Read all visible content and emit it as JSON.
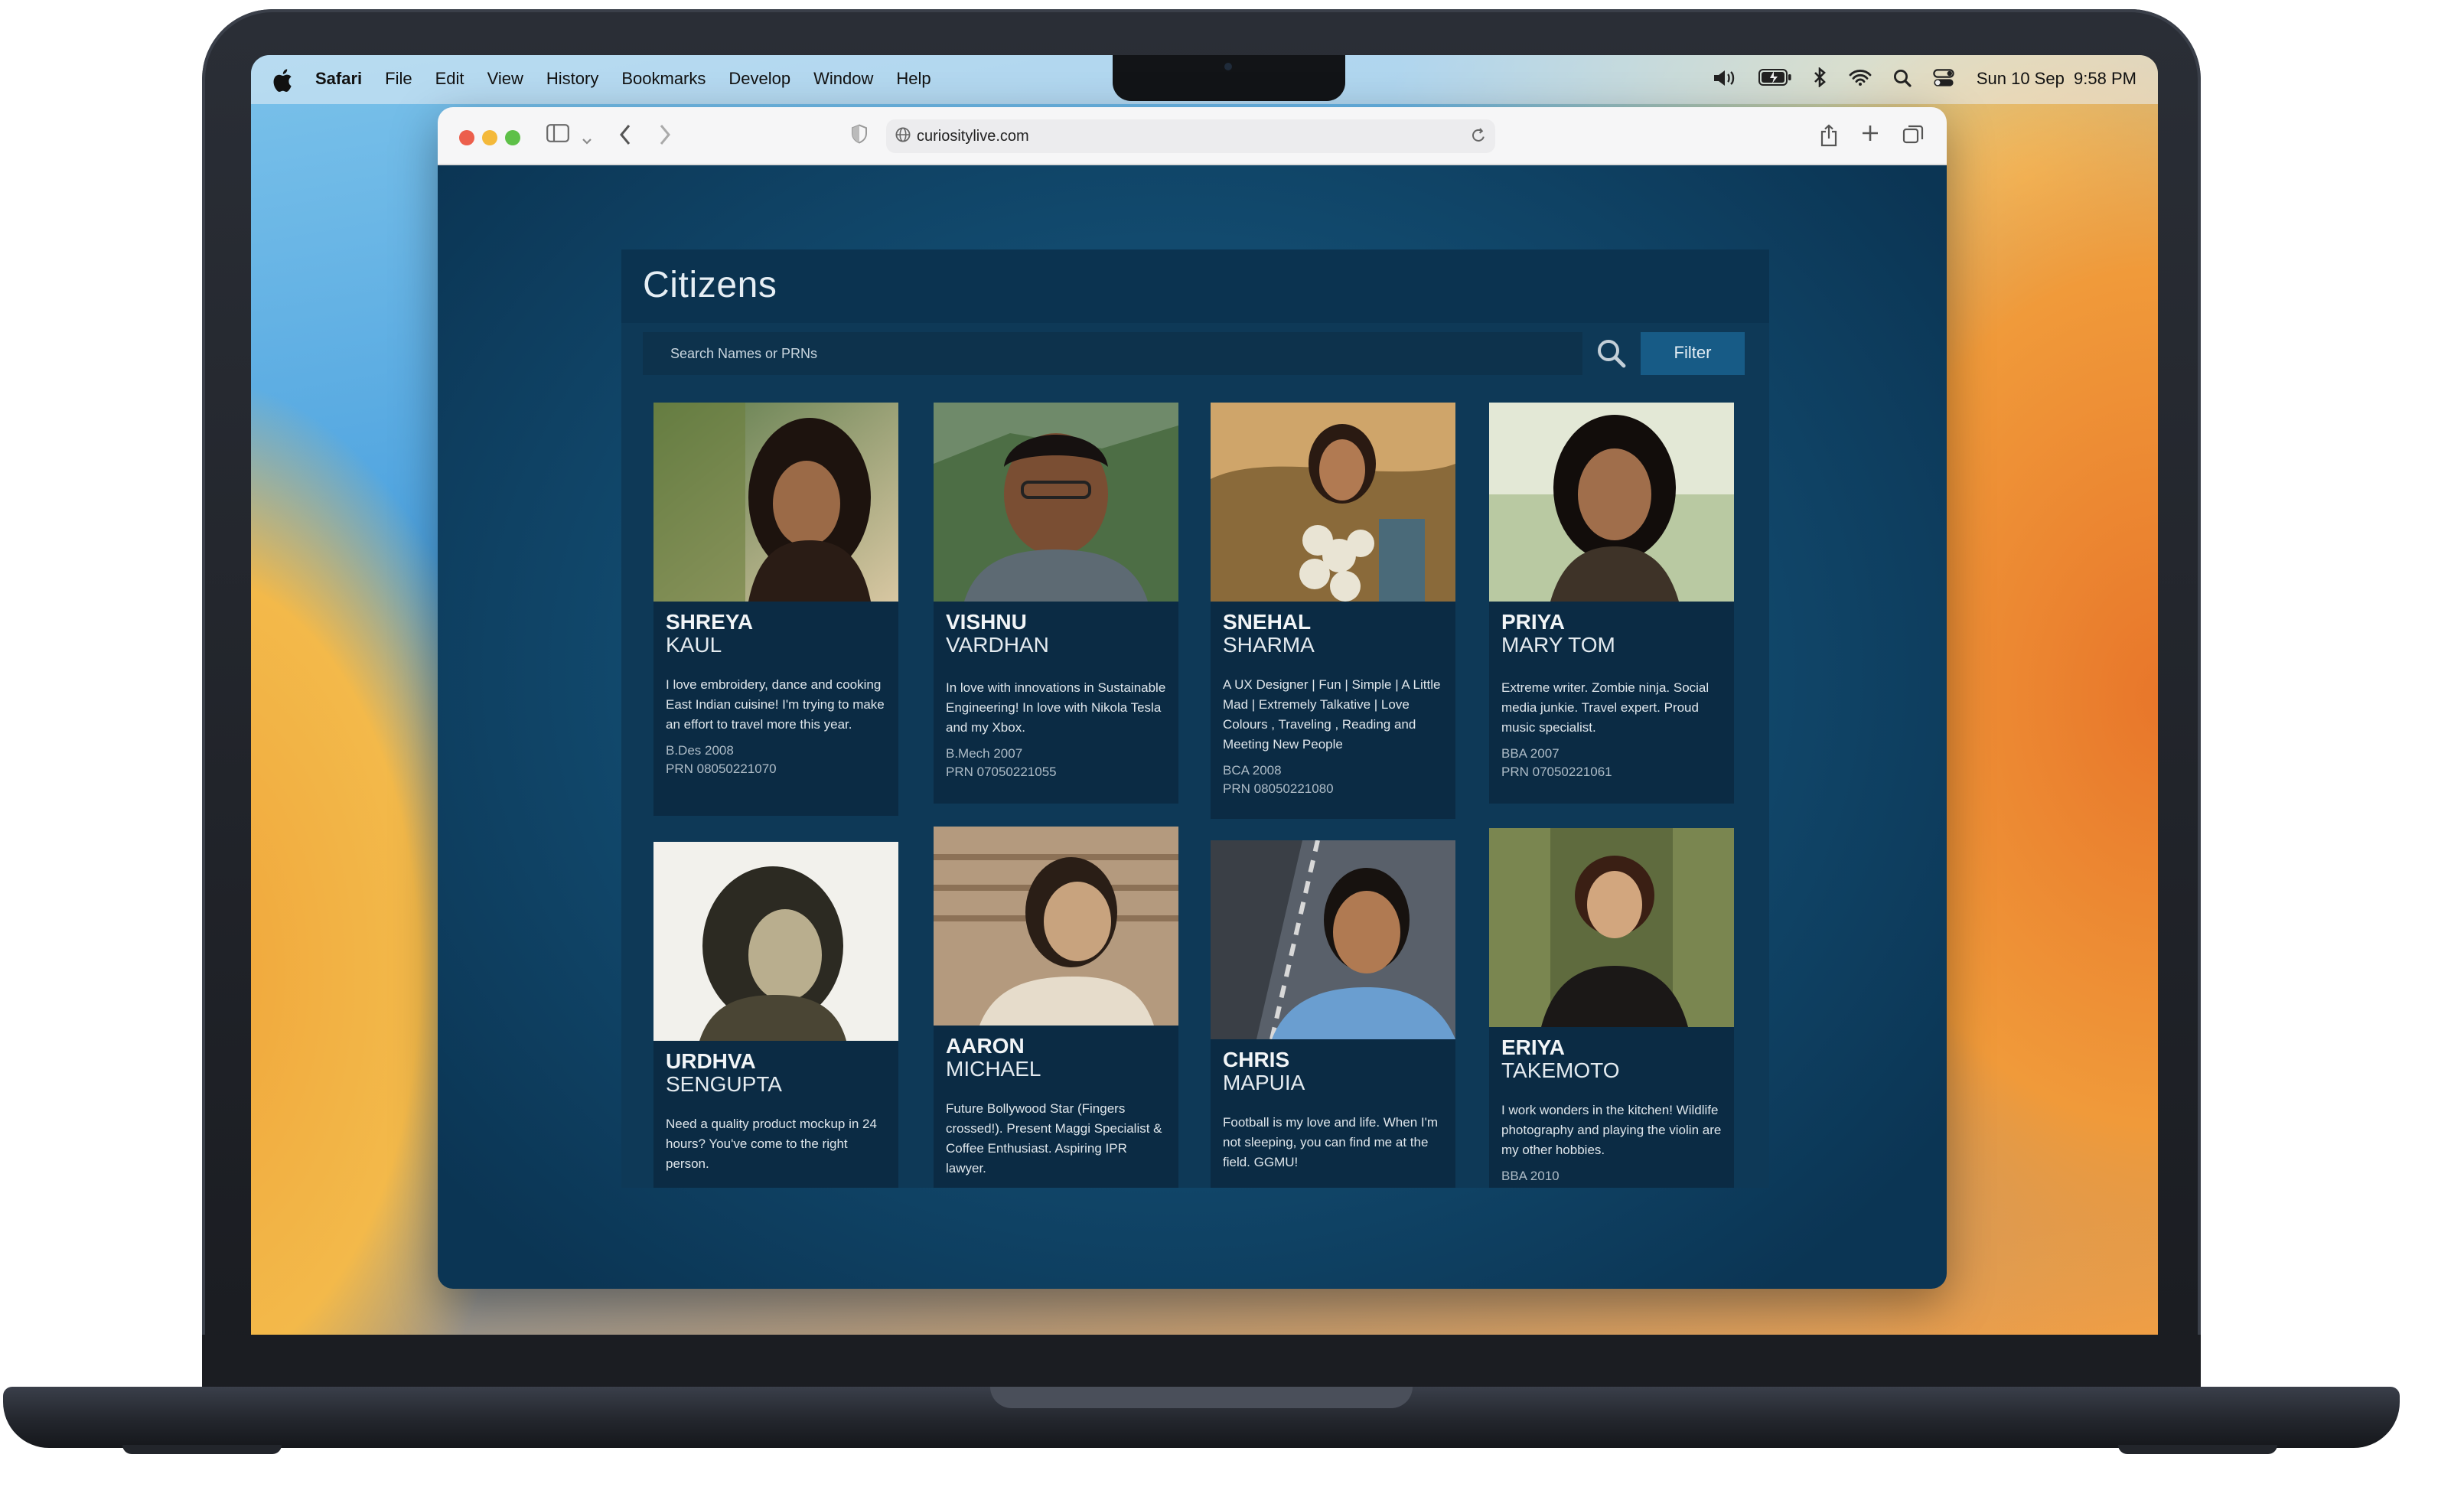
{
  "menubar": {
    "app_name": "Safari",
    "items": [
      "File",
      "Edit",
      "View",
      "History",
      "Bookmarks",
      "Develop",
      "Window",
      "Help"
    ],
    "datetime": "Sun 10 Sep  9:58 PM"
  },
  "browser": {
    "url": "curiositylive.com"
  },
  "page": {
    "title": "Citizens",
    "search_placeholder": "Search Names or PRNs",
    "filter_label": "Filter"
  },
  "people": [
    {
      "first": "SHREYA",
      "last": "KAUL",
      "bio": "I love embroidery, dance and cooking East Indian cuisine! I'm trying to make an effort to travel more this year.",
      "degree": "B.Des 2008",
      "prn": "PRN 08050221070"
    },
    {
      "first": "VISHNU",
      "last": "VARDHAN",
      "bio": "In love with innovations in Sustainable Engineering! In love with Nikola Tesla and my Xbox.",
      "degree": "B.Mech 2007",
      "prn": "PRN 07050221055"
    },
    {
      "first": "SNEHAL",
      "last": "SHARMA",
      "bio": "A UX Designer | Fun | Simple | A Little Mad | Extremely Talkative | Love Colours , Traveling , Reading and Meeting New People",
      "degree": "BCA 2008",
      "prn": "PRN 08050221080"
    },
    {
      "first": "PRIYA",
      "last": "MARY TOM",
      "bio": "Extreme writer. Zombie ninja. Social media junkie. Travel expert. Proud music specialist.",
      "degree": "BBA 2007",
      "prn": "PRN 07050221061"
    },
    {
      "first": "URDHVA",
      "last": "SENGUPTA",
      "bio": "Need a quality product mockup in 24 hours? You've come to the right person.",
      "degree": "",
      "prn": ""
    },
    {
      "first": "AARON",
      "last": "MICHAEL",
      "bio": "Future Bollywood Star (Fingers crossed!). Present Maggi Specialist & Coffee Enthusiast. Aspiring IPR lawyer.",
      "degree": "",
      "prn": ""
    },
    {
      "first": "CHRIS",
      "last": "MAPUIA",
      "bio": "Football is my love and life. When I'm not sleeping, you can find me at the field. GGMU!",
      "degree": "",
      "prn": ""
    },
    {
      "first": "ERIYA",
      "last": "TAKEMOTO",
      "bio": "I work wonders in the kitchen! Wildlife photography and playing the violin are my other hobbies.",
      "degree": "BBA 2010",
      "prn": ""
    }
  ],
  "icons": {
    "apple": "apple-logo-icon",
    "volume": "volume-icon",
    "battery": "battery-icon",
    "bluetooth": "bluetooth-icon",
    "wifi": "wifi-icon",
    "spotlight": "search-icon",
    "control_center": "control-center-icon"
  }
}
